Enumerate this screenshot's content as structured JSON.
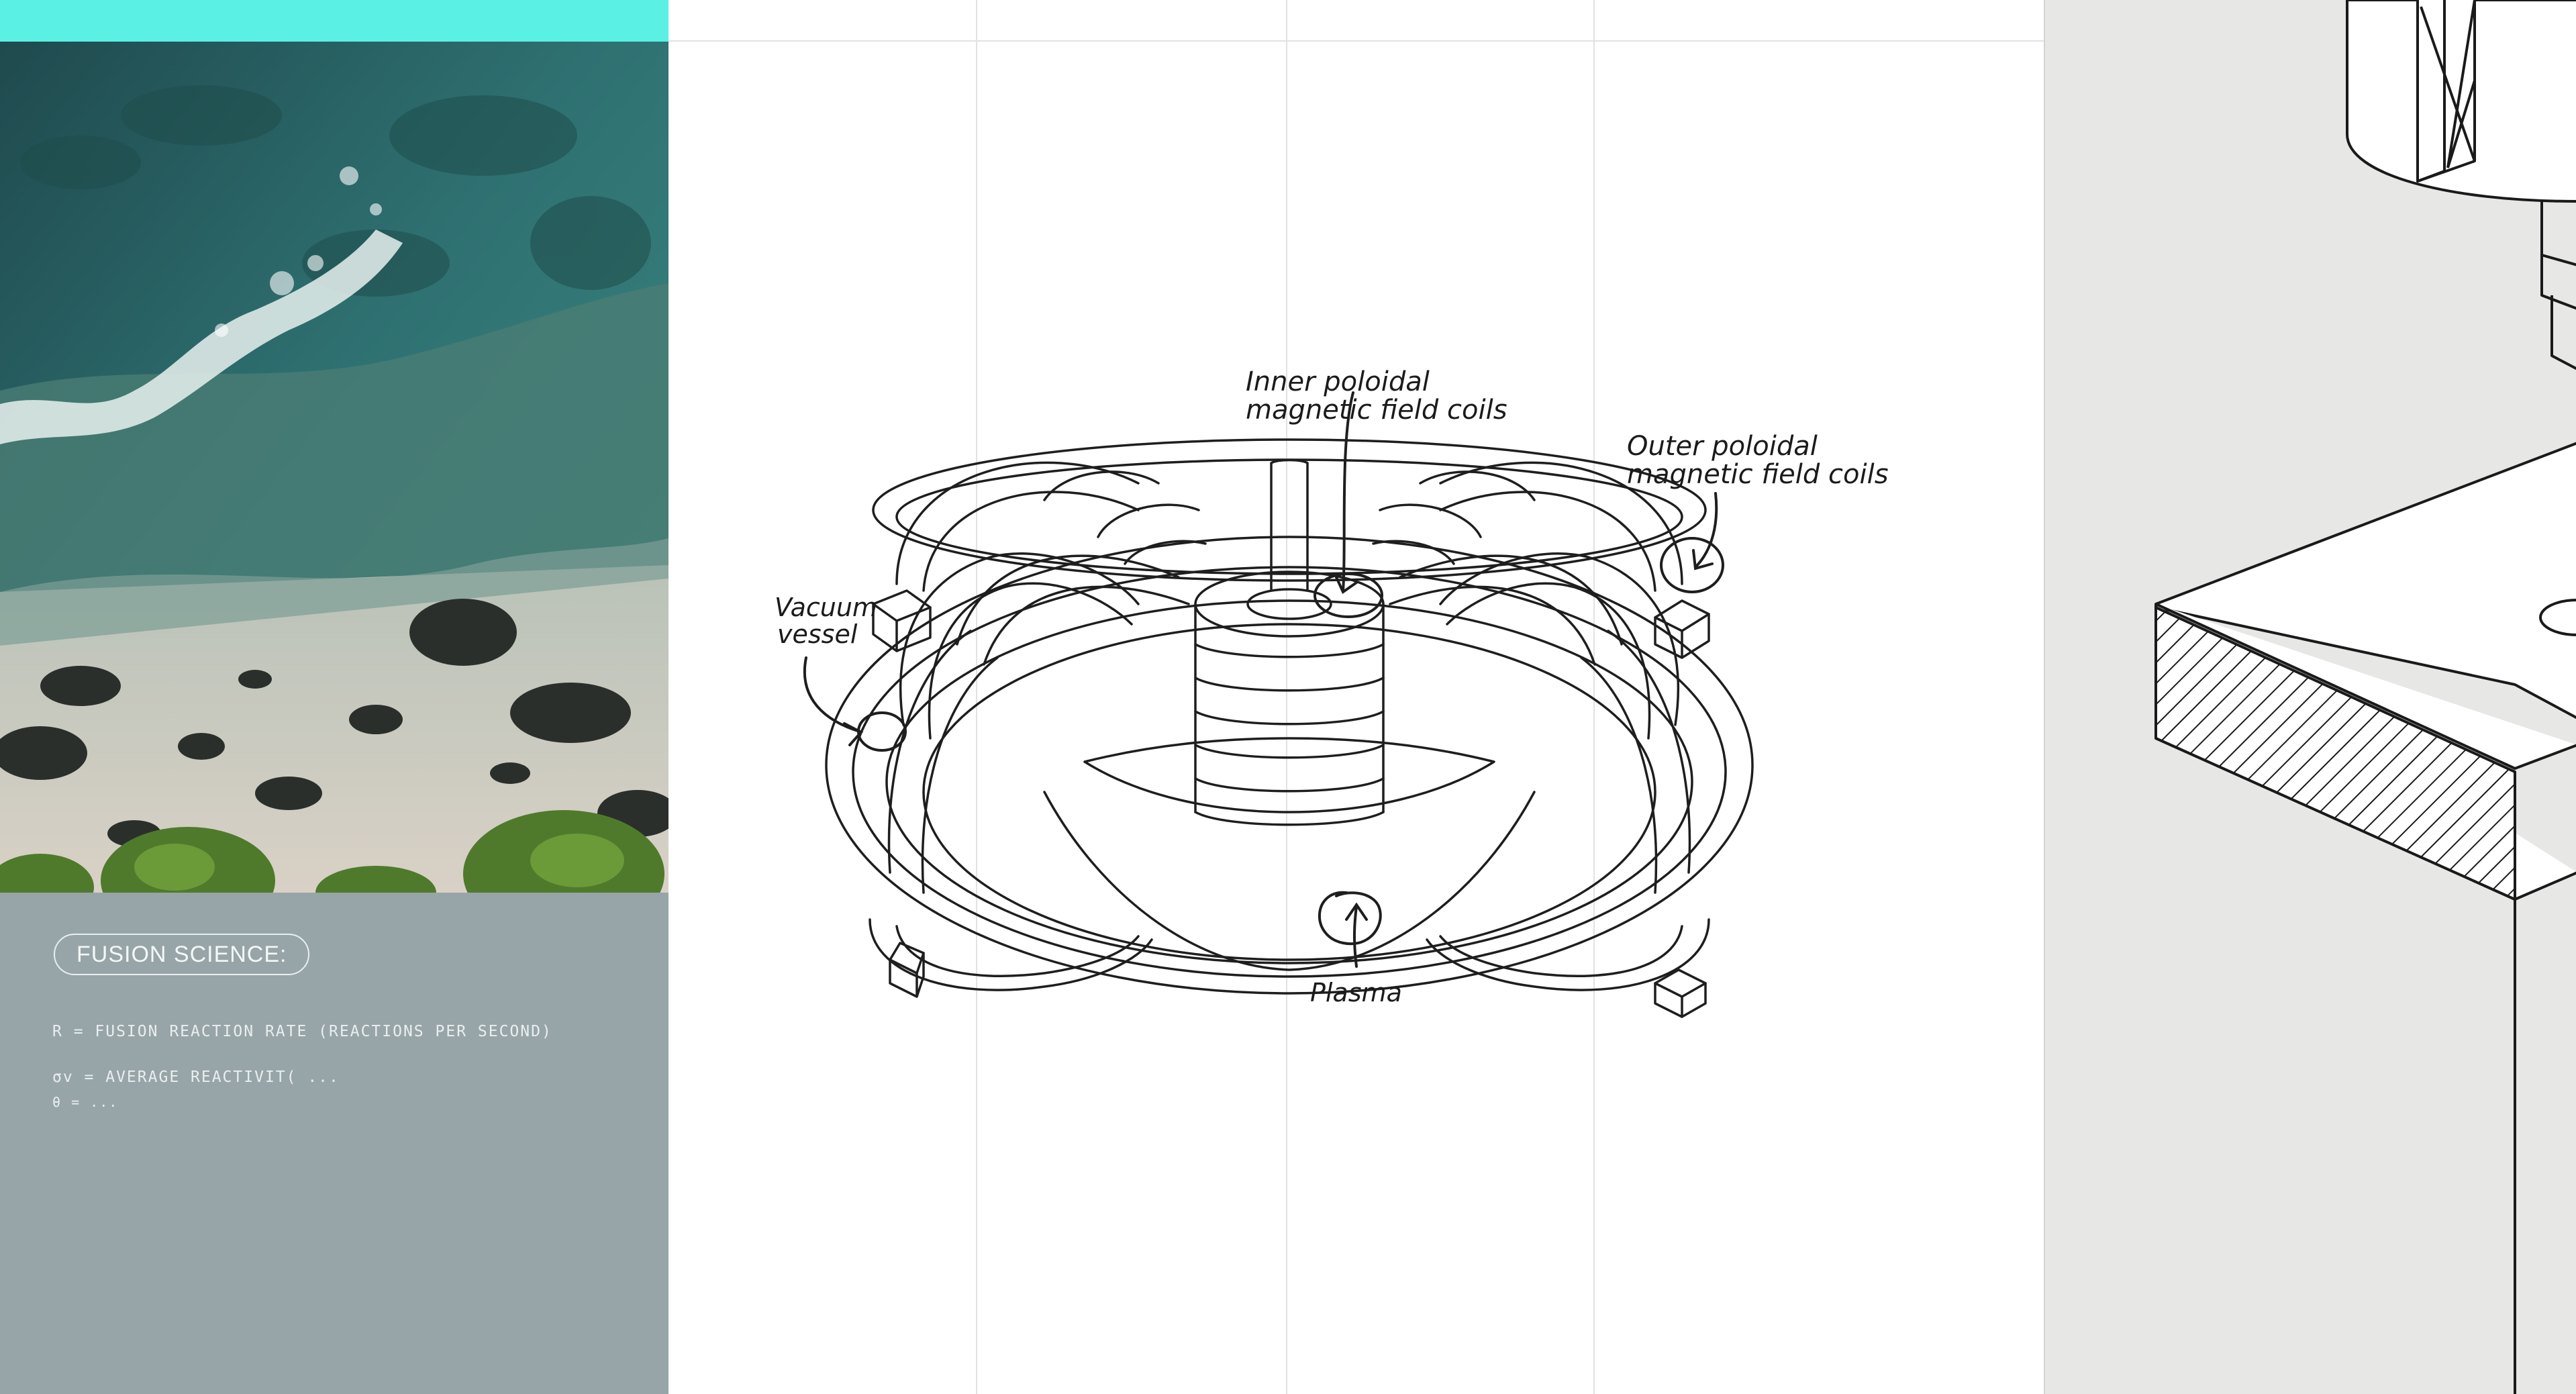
{
  "left_panel": {
    "accent_color": "#5af0e4",
    "photo": "aerial coastline",
    "topic_badge": "FUSION SCIENCE:",
    "formula_line_1": "R = FUSION REACTION RATE (REACTIONS PER SECOND)",
    "formula_line_2": "σv = AVERAGE REACTIVIT( ...",
    "formula_line_3": "θ = ..."
  },
  "diagram": {
    "labels": {
      "inner_coils_line1": "Inner poloidal",
      "inner_coils_line2": "magnetic field coils",
      "outer_coils_line1": "Outer poloidal",
      "outer_coils_line2": "magnetic field coils",
      "vacuum_line1": "Vacuum",
      "vacuum_line2": "vessel",
      "plasma": "Plasma"
    }
  },
  "right_panel": {
    "drawing": "technical CAD line drawing"
  }
}
